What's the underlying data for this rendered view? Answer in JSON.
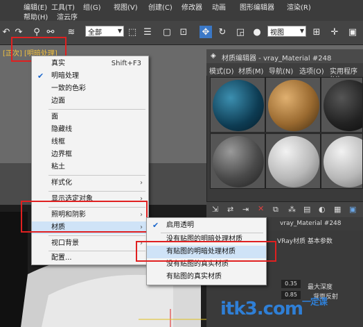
{
  "menubar": {
    "row1": [
      "编辑(E)",
      "工具(T)",
      "组(G)",
      "视图(V)",
      "创建(C)",
      "修改器",
      "动画",
      "图形编辑器",
      "渲染(R)"
    ],
    "row2": [
      "帮助(H)",
      "渲云序"
    ]
  },
  "toolbar": {
    "selection_filter": "全部",
    "view_combo": "视图"
  },
  "viewport": {
    "label": "[正次] [明暗处理]"
  },
  "context_menu": {
    "items": [
      {
        "label": "真实",
        "shortcut": "Shift+F3"
      },
      {
        "label": "明暗处理",
        "checked": true
      },
      {
        "label": "一致的色彩"
      },
      {
        "label": "边面"
      },
      {
        "label": "面"
      },
      {
        "label": "隐藏线"
      },
      {
        "label": "线框"
      },
      {
        "label": "边界框"
      },
      {
        "label": "粘土"
      },
      {
        "label": "样式化",
        "submenu": true
      },
      {
        "label": "显示选定对象",
        "submenu": true
      },
      {
        "label": "照明和阴影",
        "submenu": true
      },
      {
        "label": "材质",
        "submenu": true,
        "highlighted": true
      },
      {
        "label": "视口背景",
        "submenu": true
      },
      {
        "label": "配置..."
      }
    ]
  },
  "submenu": {
    "items": [
      {
        "label": "启用透明",
        "checked": true
      },
      {
        "label": "没有贴图的明暗处理材质"
      },
      {
        "label": "有贴图的明暗处理材质",
        "highlighted": true
      },
      {
        "label": "没有贴图的真实材质"
      },
      {
        "label": "有贴图的真实材质"
      }
    ]
  },
  "material_editor": {
    "title": "材质编辑器 - vray_Material #248",
    "menu": [
      "模式(D)",
      "材质(M)",
      "导航(N)",
      "选项(O)",
      "实用程序(U)"
    ],
    "material_name": "vray_Material #248",
    "rollout": "VRay材质 基本参数",
    "labels": [
      "最大深度",
      "背面反射"
    ],
    "values": [
      "0.35",
      "0.85"
    ]
  },
  "watermark": {
    "text": "itk3.com",
    "cn": "一定课"
  },
  "colors": {
    "red_highlight": "#e02020",
    "menu_bg": "#f3f3f3",
    "menu_highlight": "#cfe3f7",
    "watermark": "#2f7fd6"
  }
}
